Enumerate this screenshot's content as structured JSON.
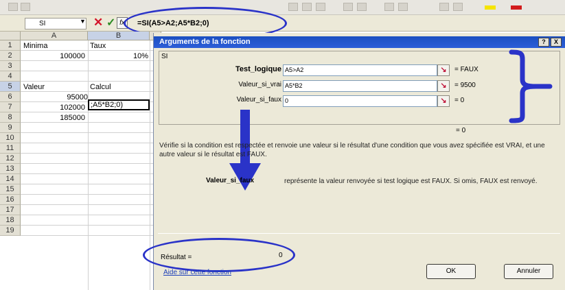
{
  "formula_bar": {
    "name_box": "SI",
    "formula": "=SI(A5>A2;A5*B2;0)",
    "fx_label": "fx"
  },
  "grid": {
    "columns": [
      "A",
      "B"
    ],
    "rows": [
      "1",
      "2",
      "3",
      "4",
      "5",
      "6",
      "7",
      "8",
      "9",
      "10",
      "11",
      "12",
      "13",
      "14",
      "15",
      "16",
      "17",
      "18",
      "19"
    ],
    "cells": {
      "A1": "Minima",
      "B1": "Taux",
      "A2": "100000",
      "B2": "10%",
      "A4": "Valeur",
      "B4": "Calcul",
      "A5": "95000",
      "B5": ";A5*B2;0)",
      "A6": "102000",
      "A7": "185000"
    }
  },
  "dialog": {
    "title": "Arguments de la fonction",
    "function_name": "SI",
    "help_glyph": "?",
    "close_glyph": "X",
    "arguments": [
      {
        "label": "Test_logique",
        "value": "A5>A2",
        "result": "= FAUX"
      },
      {
        "label": "Valeur_si_vrai",
        "value": "A5*B2",
        "result": "= 9500"
      },
      {
        "label": "Valeur_si_faux",
        "value": "0",
        "result": "= 0"
      }
    ],
    "overall_result": "= 0",
    "function_description": "Vérifie si la condition est respectée et renvoie une valeur si le résultat d'une condition que vous avez spécifiée est VRAI, et une autre valeur si le résultat est FAUX.",
    "argument_help_name": "Valeur_si_faux",
    "argument_help_text": "représente la valeur renvoyée si test logique est FAUX. Si omis, FAUX est renvoyé.",
    "result_label": "Résultat =",
    "result_value": "0",
    "help_link": "Aide sur cette fonction",
    "ok_label": "OK",
    "cancel_label": "Annuler"
  },
  "colors": {
    "annotation_blue": "#2a33c8",
    "title_bar_blue": "#1b4fc1",
    "dialog_bg": "#ece9d8",
    "cancel_red": "#d3152a",
    "enter_green": "#2b8b23"
  }
}
